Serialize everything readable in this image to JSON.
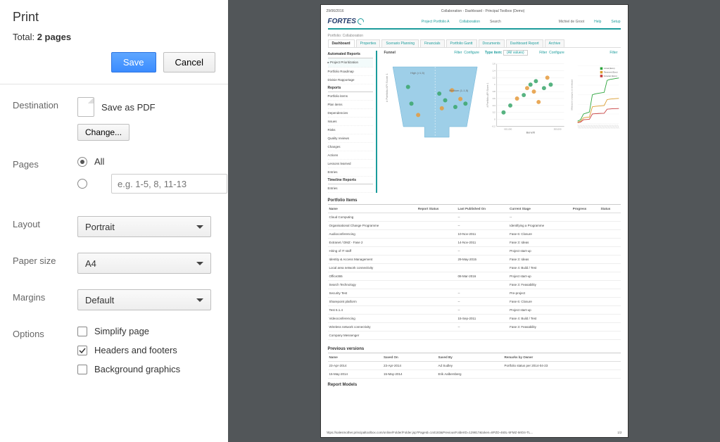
{
  "dialog": {
    "title": "Print",
    "total_prefix": "Total: ",
    "total_value": "2 pages",
    "save": "Save",
    "cancel": "Cancel",
    "destination_label": "Destination",
    "destination_value": "Save as PDF",
    "change": "Change...",
    "pages_label": "Pages",
    "pages_all": "All",
    "range_placeholder": "e.g. 1-5, 8, 11-13",
    "layout_label": "Layout",
    "layout_value": "Portrait",
    "papersize_label": "Paper size",
    "papersize_value": "A4",
    "margins_label": "Margins",
    "margins_value": "Default",
    "options_label": "Options",
    "opt_simplify": "Simplify page",
    "opt_headers": "Headers and footers",
    "opt_bg": "Background graphics"
  },
  "preview": {
    "date": "29/06/2016",
    "title": "Collaboration - Dashboard - Principal Toolbox (Demo)",
    "brand": "FORTES",
    "topnav": {
      "portfolio_a": "Project Portfolio A",
      "collaboration": "Collaboration",
      "search": "Search",
      "user": "Michiel de Groot",
      "help": "Help",
      "setup": "Setup"
    },
    "crumb": "Portfolio: Collaboration",
    "tabs": [
      "Dashboard",
      "Properties",
      "Scenario Planning",
      "Financials",
      "Portfolio Gantt",
      "Documents",
      "Dashboard Report",
      "Archive"
    ],
    "leftnav": {
      "automated": "Automated Reports",
      "auto_items": [
        "Project Prioritization",
        "Portfolio Roadmap",
        "Divisie Rapportage"
      ],
      "reports": "Reports",
      "report_items": [
        "Portfolio items",
        "Plan items",
        "Dependencies",
        "Issues",
        "Risks",
        "Quality reviews",
        "Changes",
        "Actions",
        "Lessons learned",
        "Entries"
      ],
      "timeline": "Timeline Reports",
      "timeline_items": [
        "Entries"
      ]
    },
    "chart_row": {
      "funnel": {
        "title": "Funnel",
        "filter": "Filter",
        "configure": "Configure"
      },
      "typeitem": {
        "label": "Type item:",
        "value": "(All values)",
        "filter": "Filter",
        "configure": "Configure"
      },
      "right": {
        "filter": "Filter"
      }
    },
    "portfolio_items": {
      "title": "Portfolio Items",
      "headers": [
        "Name",
        "Report Status",
        "Last Published On",
        "Current Stage",
        "Progress",
        "Status"
      ],
      "rows": [
        {
          "name": "Cloud Computing",
          "date": "--",
          "stage": "--"
        },
        {
          "name": "Organisational Change Programme",
          "date": "--",
          "stage": "Identifying a Programme"
        },
        {
          "name": "Audioconferencing",
          "date": "10-Nov-2011",
          "stage": "Fase 6: Closure"
        },
        {
          "name": "Extranet / DMZ - Fase 2",
          "date": "14-Nov-2011",
          "stage": "Fase 3: Ideas"
        },
        {
          "name": "Hiring of IT staff",
          "date": "--",
          "stage": "Project start-up"
        },
        {
          "name": "Identity & Access Management",
          "date": "29-May-2015",
          "stage": "Fase 3: Ideas"
        },
        {
          "name": "Local area network connectivity",
          "date": "",
          "stage": "Fase 4: Build / Test"
        },
        {
          "name": "Office365",
          "date": "08-Mar-2016",
          "stage": "Project start-up"
        },
        {
          "name": "Search Technology",
          "date": "",
          "stage": "Fase 3: Feasability"
        },
        {
          "name": "Security Test",
          "date": "--",
          "stage": "Pre-project"
        },
        {
          "name": "Sharepoint platform",
          "date": "--",
          "stage": "Fase 6: Closure"
        },
        {
          "name": "Test 6.1.4",
          "date": "--",
          "stage": "Project start-up"
        },
        {
          "name": "Videoconferencing",
          "date": "15-Sep-2011",
          "stage": "Fase 4: Build / Test"
        },
        {
          "name": "Wireless network connectivity",
          "date": "--",
          "stage": "Fase 3: Feasability"
        },
        {
          "name": "Company Messenger",
          "date": "",
          "stage": ""
        }
      ]
    },
    "previous_versions": {
      "title": "Previous versions",
      "headers": [
        "Name",
        "Saved On",
        "Saved By",
        "Remarks by Owner"
      ],
      "rows": [
        {
          "name": "23-Apr-2014",
          "on": "23-Apr-2014",
          "by": "Ad Sudley",
          "rem": "Portfolio status per 2014-04-23"
        },
        {
          "name": "15-May-2014",
          "on": "15-May-2014",
          "by": "Erik Aalbersberg",
          "rem": ""
        }
      ]
    },
    "report_models": "Report Models",
    "footer_url": "https://salesmother.principaltoolbox.com/online/Folder/Folder.jsp?PageId=144183&PreviousFolderID=129817&token=8PZD-460L-5FMZ-MIO4-TL...",
    "footer_page": "1/2"
  },
  "chart_data": [
    {
      "type": "funnel",
      "title": "Funnel",
      "ylabel": "# Portfolio-KPI Score 1",
      "stages": [
        "High (>1,5)",
        "Medium (1-1,5)"
      ],
      "points": [
        {
          "stage": 0,
          "x": 0.18,
          "y": 0.3,
          "color": "green"
        },
        {
          "stage": 0,
          "x": 0.22,
          "y": 0.55,
          "color": "green"
        },
        {
          "stage": 0,
          "x": 0.3,
          "y": 0.72,
          "color": "orange"
        },
        {
          "stage": 1,
          "x": 0.55,
          "y": 0.4,
          "color": "green"
        },
        {
          "stage": 1,
          "x": 0.58,
          "y": 0.62,
          "color": "orange"
        },
        {
          "stage": 1,
          "x": 0.62,
          "y": 0.5,
          "color": "green"
        },
        {
          "stage": 1,
          "x": 0.7,
          "y": 0.35,
          "color": "orange"
        },
        {
          "stage": 1,
          "x": 0.74,
          "y": 0.6,
          "color": "green"
        },
        {
          "stage": 1,
          "x": 0.8,
          "y": 0.48,
          "color": "orange"
        },
        {
          "stage": 1,
          "x": 0.86,
          "y": 0.55,
          "color": "green"
        }
      ]
    },
    {
      "type": "scatter",
      "xlabel": "Benefit",
      "ylabel": "# Portfolio-API Score 1",
      "xlim": [
        -501000,
        500000
      ],
      "ylim": [
        -0.2,
        1.6
      ],
      "yticks": [
        -0.2,
        0,
        0.2,
        0.4,
        0.6,
        0.8,
        1.0,
        1.2,
        1.4,
        1.6
      ],
      "points": [
        {
          "x": -400000,
          "y": 0.2,
          "color": "green"
        },
        {
          "x": -300000,
          "y": 0.4,
          "color": "green"
        },
        {
          "x": -200000,
          "y": 0.6,
          "color": "orange"
        },
        {
          "x": -100000,
          "y": 0.7,
          "color": "green"
        },
        {
          "x": -50000,
          "y": 0.9,
          "color": "orange"
        },
        {
          "x": 0,
          "y": 1.0,
          "color": "green"
        },
        {
          "x": 50000,
          "y": 0.8,
          "color": "orange"
        },
        {
          "x": 80000,
          "y": 1.1,
          "color": "green"
        },
        {
          "x": 120000,
          "y": 0.5,
          "color": "orange"
        },
        {
          "x": 200000,
          "y": 0.9,
          "color": "green"
        },
        {
          "x": 250000,
          "y": 1.2,
          "color": "orange"
        },
        {
          "x": 300000,
          "y": 1.0,
          "color": "green"
        }
      ]
    },
    {
      "type": "line",
      "ylabel": "Milestone changes on timebase",
      "ylim": [
        0,
        120000
      ],
      "legend": [
        "Actual (Euro)",
        "Reserved (Euro)",
        "Forecast (Euro)"
      ],
      "series": [
        {
          "name": "Actual (Euro)",
          "color": "#2aa43a",
          "values": [
            5000,
            8000,
            20000,
            22000,
            24000,
            60000,
            62000,
            63000,
            64000,
            65000,
            90000,
            92000,
            93000,
            94000,
            95000
          ]
        },
        {
          "name": "Reserved (Euro)",
          "color": "#d99a2b",
          "values": [
            3000,
            5000,
            12000,
            13000,
            13500,
            35000,
            36000,
            36500,
            37000,
            37500,
            50000,
            51000,
            51500,
            52000,
            52500
          ]
        },
        {
          "name": "Forecast (Euro)",
          "color": "#c63a3a",
          "values": [
            2000,
            3000,
            8000,
            8500,
            9000,
            20000,
            20500,
            21000,
            21200,
            21400,
            30000,
            30500,
            31000,
            31200,
            31400
          ]
        }
      ]
    }
  ]
}
